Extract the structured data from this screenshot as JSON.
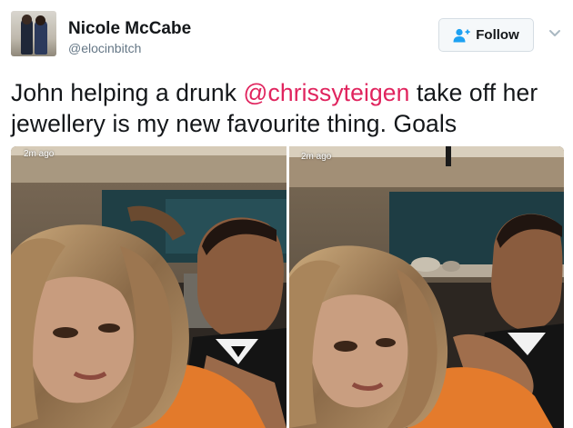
{
  "author": {
    "display_name": "Nicole McCabe",
    "handle": "@elocinbitch",
    "avatar": "profile-photo"
  },
  "actions": {
    "follow_label": "Follow",
    "follow_icon": "add-user-icon",
    "menu_icon": "chevron-down-icon"
  },
  "tweet": {
    "text_before": "John helping a drunk ",
    "mention": "@chrissyteigen",
    "text_after": " take off her jewellery is my new favourite thing. Goals"
  },
  "media": {
    "photos": [
      {
        "overlay_time": "2m ago"
      },
      {
        "overlay_time": "2m ago"
      }
    ]
  },
  "colors": {
    "mention": "#e0245e",
    "follow_icon": "#1da1f2",
    "handle": "#657786"
  }
}
